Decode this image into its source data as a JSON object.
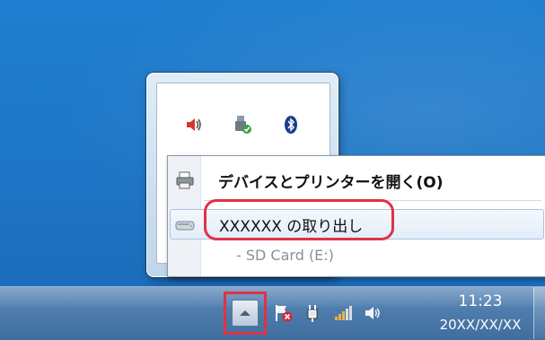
{
  "context_menu": {
    "items": [
      {
        "label": "デバイスとプリンターを開く(O)",
        "icon": "printer-icon"
      },
      {
        "label": "XXXXXX の取り出し",
        "icon": "drive-icon",
        "highlighted": true
      },
      {
        "label": "- SD Card (E:)",
        "disabled": true
      }
    ]
  },
  "tray_flyout": {
    "icons": [
      "speaker-muted-icon",
      "usb-safely-remove-icon",
      "bluetooth-icon",
      "monitor-icon",
      "display-icon",
      "tool-icon"
    ]
  },
  "taskbar": {
    "show_hidden_icons": "chevron-up-icon",
    "icons": [
      "action-center-flag-icon",
      "network-plug-icon",
      "signal-bars-icon",
      "volume-icon"
    ],
    "clock": {
      "time": "11:23",
      "date": "20XX/XX/XX"
    }
  },
  "colors": {
    "callout": "#e03247",
    "desktop": "#1e74c4",
    "taskbar": "#4f7eae"
  }
}
